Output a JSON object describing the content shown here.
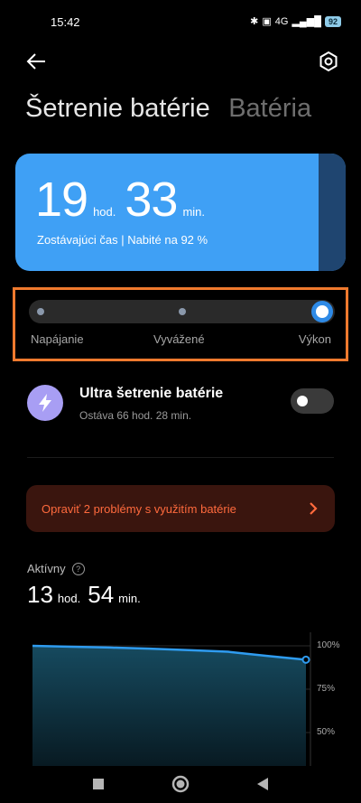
{
  "status_bar": {
    "time": "15:42",
    "network": "4G",
    "battery": "92"
  },
  "header": {
    "title_active": "Šetrenie batérie",
    "title_inactive": "Batéria"
  },
  "battery_card": {
    "hours": "19",
    "hours_unit": "hod.",
    "minutes": "33",
    "minutes_unit": "min.",
    "subtitle": "Zostávajúci čas | Nabité na 92 %"
  },
  "modes": {
    "options": [
      "Napájanie",
      "Vyvážené",
      "Výkon"
    ],
    "selected": "Výkon"
  },
  "ultra_saver": {
    "title": "Ultra šetrenie batérie",
    "subtitle": "Ostáva 66 hod. 28 min.",
    "enabled": false
  },
  "issues": {
    "label": "Opraviť 2 problémy s využitím batérie"
  },
  "active": {
    "label": "Aktívny",
    "hours": "13",
    "hours_unit": "hod.",
    "minutes": "54",
    "minutes_unit": "min."
  },
  "chart_data": {
    "type": "area",
    "y_ticks": [
      "100%",
      "75%",
      "50%"
    ],
    "ylim": [
      50,
      100
    ],
    "values": [
      100,
      99.5,
      99,
      98.4,
      97.5,
      96.6,
      94.2,
      92.0
    ],
    "grid": true
  },
  "colors": {
    "accent": "#3fa0f5",
    "mode_highlight": "#f07a2e",
    "issue_text": "#ff6a3d",
    "ultra_icon": "#a89ef4"
  }
}
